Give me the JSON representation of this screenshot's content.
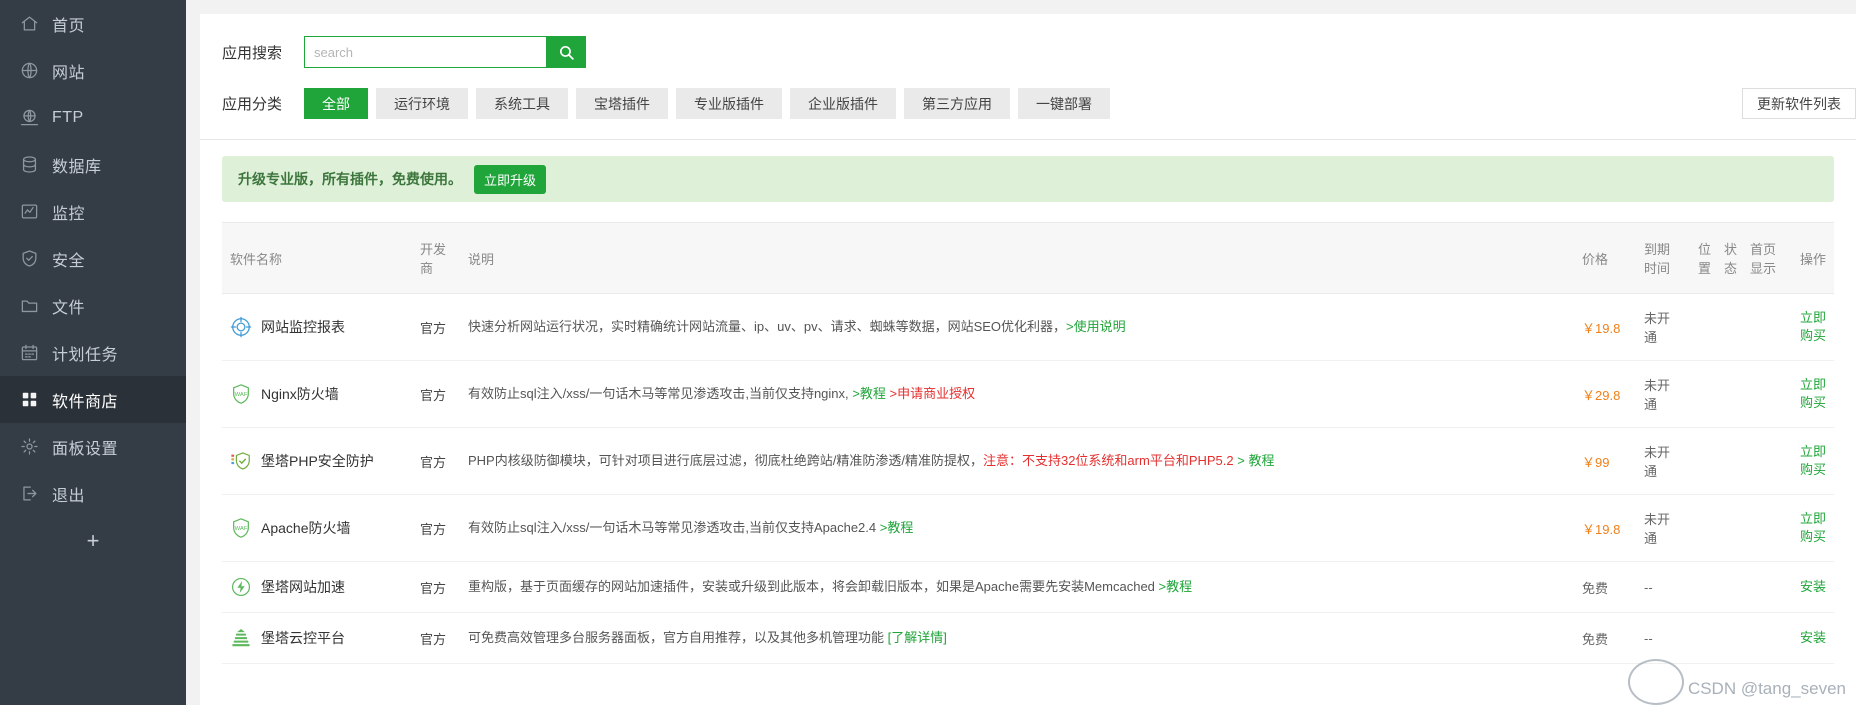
{
  "sidebar": {
    "items": [
      {
        "label": "首页",
        "icon": "home-icon",
        "active": false
      },
      {
        "label": "网站",
        "icon": "globe-icon",
        "active": false
      },
      {
        "label": "FTP",
        "icon": "ftp-icon",
        "active": false
      },
      {
        "label": "数据库",
        "icon": "database-icon",
        "active": false
      },
      {
        "label": "监控",
        "icon": "monitor-icon",
        "active": false
      },
      {
        "label": "安全",
        "icon": "shield-icon",
        "active": false
      },
      {
        "label": "文件",
        "icon": "folder-icon",
        "active": false
      },
      {
        "label": "计划任务",
        "icon": "calendar-icon",
        "active": false
      },
      {
        "label": "软件商店",
        "icon": "grid-icon",
        "active": true
      },
      {
        "label": "面板设置",
        "icon": "gear-icon",
        "active": false
      },
      {
        "label": "退出",
        "icon": "logout-icon",
        "active": false
      }
    ],
    "add_label": "+"
  },
  "search": {
    "label": "应用搜索",
    "placeholder": "search",
    "value": "",
    "button_icon": "search-icon"
  },
  "categories": {
    "label": "应用分类",
    "items": [
      {
        "label": "全部",
        "active": true
      },
      {
        "label": "运行环境",
        "active": false
      },
      {
        "label": "系统工具",
        "active": false
      },
      {
        "label": "宝塔插件",
        "active": false
      },
      {
        "label": "专业版插件",
        "active": false
      },
      {
        "label": "企业版插件",
        "active": false
      },
      {
        "label": "第三方应用",
        "active": false
      },
      {
        "label": "一键部署",
        "active": false
      }
    ],
    "update_button": "更新软件列表"
  },
  "banner": {
    "text": "升级专业版，所有插件，免费使用。",
    "button": "立即升级"
  },
  "table": {
    "headers": {
      "name": "软件名称",
      "dev": "开发商",
      "desc": "说明",
      "price": "价格",
      "expire": "到期时间",
      "position": "位置",
      "status": "状态",
      "homepage": "首页显示",
      "action": "操作"
    },
    "rows": [
      {
        "name": "网站监控报表",
        "icon": "monitor-report-icon",
        "icon_color": "#3f9bd8",
        "dev": "官方",
        "desc_parts": [
          {
            "text": "快速分析网站运行状况，实时精确统计网站流量、ip、uv、pv、请求、蜘蛛等数据，网站SEO优化利器，",
            "style": "normal"
          },
          {
            "text": ">使用说明",
            "style": "green"
          }
        ],
        "price": "￥19.8",
        "price_free": false,
        "expire": "未开通",
        "position": "",
        "status": "",
        "homepage": "",
        "action": "立即购买"
      },
      {
        "name": "Nginx防火墙",
        "icon": "waf-shield-icon",
        "icon_color": "#5bb85b",
        "dev": "官方",
        "desc_parts": [
          {
            "text": "有效防止sql注入/xss/一句话木马等常见渗透攻击,当前仅支持nginx, ",
            "style": "normal"
          },
          {
            "text": ">教程",
            "style": "green"
          },
          {
            "text": " >申请商业授权",
            "style": "red"
          }
        ],
        "price": "￥29.8",
        "price_free": false,
        "expire": "未开通",
        "position": "",
        "status": "",
        "homepage": "",
        "action": "立即购买"
      },
      {
        "name": "堡塔PHP安全防护",
        "icon": "php-shield-icon",
        "icon_color": "#6fae3c",
        "dev": "官方",
        "desc_parts": [
          {
            "text": "PHP内核级防御模块，可针对项目进行底层过滤，彻底杜绝跨站/精准防渗透/精准防提权，",
            "style": "normal"
          },
          {
            "text": "注意：不支持32位系统和arm平台和PHP5.2",
            "style": "red"
          },
          {
            "text": " > 教程",
            "style": "green"
          }
        ],
        "price": "￥99",
        "price_free": false,
        "expire": "未开通",
        "position": "",
        "status": "",
        "homepage": "",
        "action": "立即购买"
      },
      {
        "name": "Apache防火墙",
        "icon": "waf-shield-icon",
        "icon_color": "#5bb85b",
        "dev": "官方",
        "desc_parts": [
          {
            "text": "有效防止sql注入/xss/一句话木马等常见渗透攻击,当前仅支持Apache2.4 ",
            "style": "normal"
          },
          {
            "text": ">教程",
            "style": "green"
          }
        ],
        "price": "￥19.8",
        "price_free": false,
        "expire": "未开通",
        "position": "",
        "status": "",
        "homepage": "",
        "action": "立即购买"
      },
      {
        "name": "堡塔网站加速",
        "icon": "bolt-icon",
        "icon_color": "#5bb85b",
        "dev": "官方",
        "desc_parts": [
          {
            "text": "重构版，基于页面缓存的网站加速插件，安装或升级到此版本，将会卸载旧版本，如果是Apache需要先安装Memcached ",
            "style": "normal"
          },
          {
            "text": ">教程",
            "style": "green"
          }
        ],
        "price": "免费",
        "price_free": true,
        "expire": "--",
        "position": "",
        "status": "",
        "homepage": "",
        "action": "安装"
      },
      {
        "name": "堡塔云控平台",
        "icon": "cloud-tower-icon",
        "icon_color": "#5bb85b",
        "dev": "官方",
        "desc_parts": [
          {
            "text": "可免费高效管理多台服务器面板，官方自用推荐，以及其他多机管理功能 ",
            "style": "normal"
          },
          {
            "text": "[了解详情]",
            "style": "green"
          }
        ],
        "price": "免费",
        "price_free": true,
        "expire": "--",
        "position": "",
        "status": "",
        "homepage": "",
        "action": "安装"
      }
    ]
  },
  "watermark": {
    "text": "CSDN @tang_seven"
  },
  "colors": {
    "accent_green": "#20a53a",
    "sidebar_bg": "#343c46",
    "sidebar_active": "#2b3138",
    "price_orange": "#f0801a",
    "warn_red": "#e52f2f",
    "banner_bg": "#dff0d8"
  }
}
